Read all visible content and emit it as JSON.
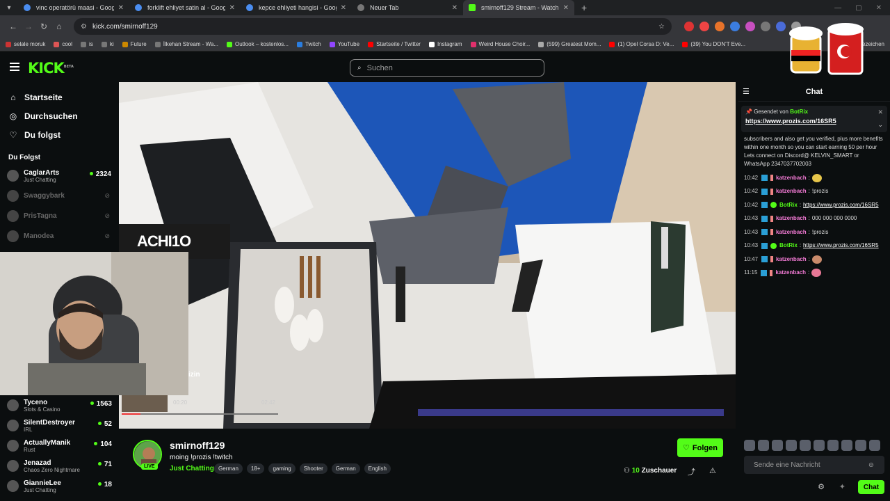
{
  "browser": {
    "tabs": [
      {
        "title": "vinc operatörü maasi - Google",
        "kind": "google"
      },
      {
        "title": "forklift ehliyet satin al - Google",
        "kind": "google"
      },
      {
        "title": "kepce ehliyeti hangisi - Google",
        "kind": "google"
      },
      {
        "title": "Neuer Tab",
        "kind": "new"
      },
      {
        "title": "smirnoff129 Stream - Watch",
        "kind": "kick"
      }
    ],
    "url": "kick.com/smirnoff129",
    "bookmarks": [
      "selale moruk",
      "cool",
      "is",
      "ki",
      "Future",
      "İlkehan Stream - Wa...",
      "Outlook – kostenlos...",
      "Twitch",
      "YouTube",
      "Startseite / Twitter",
      "Instagram",
      "Weird House Choir...",
      "(599) Greatest Mom...",
      "(1) Opel Corsa D: Ve...",
      "(39) You DON'T Eve..."
    ],
    "bookmarks_right": "Lesezeichen"
  },
  "header": {
    "logo": "KICK",
    "logo_badge": "BETA",
    "search_placeholder": "Suchen"
  },
  "sidebar": {
    "nav": [
      {
        "label": "Startseite",
        "icon": "home-icon"
      },
      {
        "label": "Durchsuchen",
        "icon": "compass-icon"
      },
      {
        "label": "Du folgst",
        "icon": "heart-icon"
      }
    ],
    "follow_title": "Du Folgst",
    "following": [
      {
        "name": "CaglarArts",
        "category": "Just Chatting",
        "viewers": "2324",
        "online": true
      },
      {
        "name": "Swaggybark",
        "category": "",
        "viewers": "",
        "online": false
      },
      {
        "name": "PrisTagna",
        "category": "",
        "viewers": "",
        "online": false
      },
      {
        "name": "Manodea",
        "category": "",
        "viewers": "",
        "online": false
      }
    ],
    "following_lower": [
      {
        "name": "Tyceno",
        "category": "Slots & Casino",
        "viewers": "1563"
      },
      {
        "name": "SilentDestroyer",
        "category": "IRL",
        "viewers": "52"
      },
      {
        "name": "ActuallyManik",
        "category": "Rust",
        "viewers": "104"
      },
      {
        "name": "Jenazad",
        "category": "Chaos Zero Nightmare",
        "viewers": "71"
      },
      {
        "name": "GiannieLee",
        "category": "Just Chatting",
        "viewers": "18"
      }
    ]
  },
  "video": {
    "overlay_label": "ACHI1O",
    "clip_caption": "izin",
    "clip_time_current": "00:20",
    "clip_time_total": "02:42",
    "clip_progress": 0.12
  },
  "channel": {
    "name": "smirnoff129",
    "title": "moing  !prozis !twitch",
    "category": "Just Chatting",
    "live_badge": "LIVE",
    "tags": [
      "German",
      "18+",
      "gaming",
      "Shooter",
      "German",
      "English"
    ],
    "follow_label": "Folgen",
    "viewers_count": "10",
    "viewers_label": "Zuschauer"
  },
  "chat": {
    "title": "Chat",
    "pinned_from_label": "Gesendet von",
    "pinned_from_user": "BotRix",
    "pinned_link": "https://www.prozis.com/16SR5",
    "intro_text": "subscribers and also get you verified, plus more benefits within one month so you can start earning 50 per hour Lets connect on Discord@ KELVIN_SMART or WhatsApp 2347037702003",
    "messages": [
      {
        "time": "10:42",
        "user": "katzenbach",
        "text": "",
        "bot": false,
        "emote": true
      },
      {
        "time": "10:42",
        "user": "katzenbach",
        "text": "!prozis",
        "bot": false,
        "emote": false
      },
      {
        "time": "10:42",
        "user": "BotRix",
        "text": "https://www.prozis.com/16SR5",
        "bot": true,
        "emote": false
      },
      {
        "time": "10:43",
        "user": "katzenbach",
        "text": "000 000 000 0000",
        "bot": false,
        "emote": false
      },
      {
        "time": "10:43",
        "user": "katzenbach",
        "text": "!prozis",
        "bot": false,
        "emote": false
      },
      {
        "time": "10:43",
        "user": "BotRix",
        "text": "https://www.prozis.com/16SR5",
        "bot": true,
        "emote": false
      },
      {
        "time": "10:47",
        "user": "katzenbach",
        "text": "",
        "bot": false,
        "emote": true
      },
      {
        "time": "11:15",
        "user": "katzenbach",
        "text": "",
        "bot": false,
        "emote": true
      }
    ],
    "input_placeholder": "Sende eine Nachricht",
    "send_label": "Chat"
  },
  "colors": {
    "accent": "#53fc18",
    "bg": "#0b0e0f"
  }
}
